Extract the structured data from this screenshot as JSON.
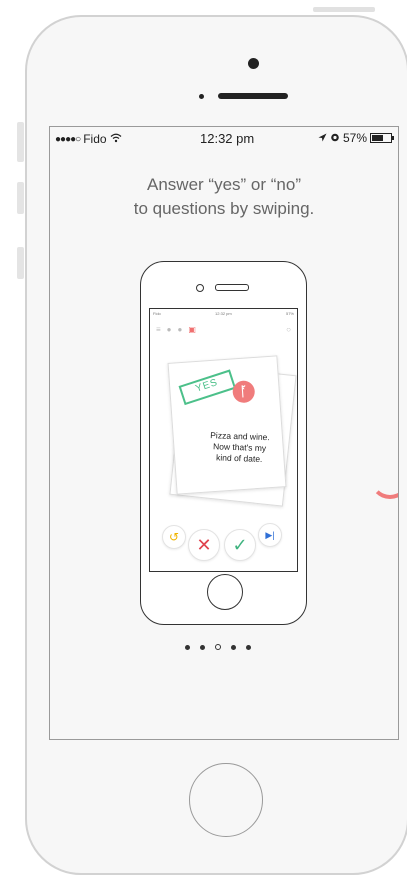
{
  "status": {
    "carrier": "Fido",
    "time": "12:32 pm",
    "battery_text": "57%",
    "battery_level": 0.57
  },
  "headline": {
    "line1": "Answer “yes” or “no”",
    "line2": "to questions by swiping."
  },
  "mini_app": {
    "status_carrier": "Fido",
    "status_time": "12:32 pm",
    "status_battery": "57%",
    "stamp": "YES",
    "card_text_line1": "Pizza and wine.",
    "card_text_line2": "Now that's my",
    "card_text_line3": "kind of date.",
    "icons": [
      "menu-icon",
      "flame-icon",
      "chat-icon",
      "cards-icon",
      "search-icon"
    ],
    "action_icons": [
      "undo-icon",
      "close-icon",
      "check-icon",
      "skip-icon"
    ]
  },
  "pager": {
    "total": 5,
    "current": 3
  },
  "colors": {
    "accent": "#f07c7c",
    "yes_green": "#4cc08a",
    "no_red": "#e0424d",
    "skip_blue": "#2f6fd6",
    "undo_yellow": "#f0b400"
  }
}
